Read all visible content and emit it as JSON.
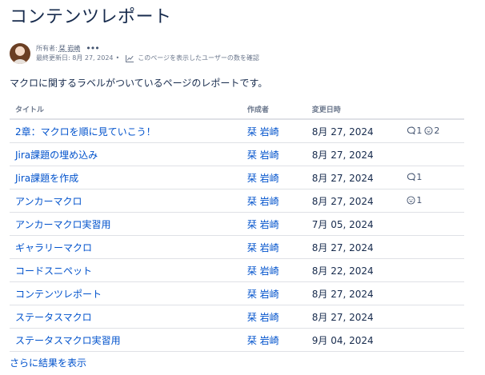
{
  "page": {
    "title": "コンテンツレポート"
  },
  "byline": {
    "owner_label": "所有者:",
    "owner_name": "栞 岩崎",
    "more_icon": "ellipsis-icon",
    "last_updated": "最終更新日: 8月 27, 2024",
    "analytics_icon": "chart-icon",
    "analytics_text": "このページを表示したユーザーの数を確認"
  },
  "report": {
    "description": "マクロに関するラベルがついているページのレポートです。",
    "columns": {
      "title": "タイトル",
      "creator": "作成者",
      "modified": "変更日時"
    },
    "rows": [
      {
        "title": "2章：マクロを順に見ていこう！",
        "creator": "栞 岩崎",
        "modified": "8月 27, 2024",
        "comments": "1",
        "likes": "2"
      },
      {
        "title": "Jira課題の埋め込み",
        "creator": "栞 岩崎",
        "modified": "8月 27, 2024",
        "comments": "",
        "likes": ""
      },
      {
        "title": "Jira課題を作成",
        "creator": "栞 岩崎",
        "modified": "8月 27, 2024",
        "comments": "1",
        "likes": ""
      },
      {
        "title": "アンカーマクロ",
        "creator": "栞 岩崎",
        "modified": "8月 27, 2024",
        "comments": "",
        "likes": "1"
      },
      {
        "title": "アンカーマクロ実習用",
        "creator": "栞 岩崎",
        "modified": "7月 05, 2024",
        "comments": "",
        "likes": ""
      },
      {
        "title": "ギャラリーマクロ",
        "creator": "栞 岩崎",
        "modified": "8月 27, 2024",
        "comments": "",
        "likes": ""
      },
      {
        "title": "コードスニペット",
        "creator": "栞 岩崎",
        "modified": "8月 22, 2024",
        "comments": "",
        "likes": ""
      },
      {
        "title": "コンテンツレポート",
        "creator": "栞 岩崎",
        "modified": "8月 27, 2024",
        "comments": "",
        "likes": ""
      },
      {
        "title": "ステータスマクロ",
        "creator": "栞 岩崎",
        "modified": "8月 27, 2024",
        "comments": "",
        "likes": ""
      },
      {
        "title": "ステータスマクロ実習用",
        "creator": "栞 岩崎",
        "modified": "9月 04, 2024",
        "comments": "",
        "likes": ""
      }
    ],
    "more_results": "さらに結果を表示"
  }
}
